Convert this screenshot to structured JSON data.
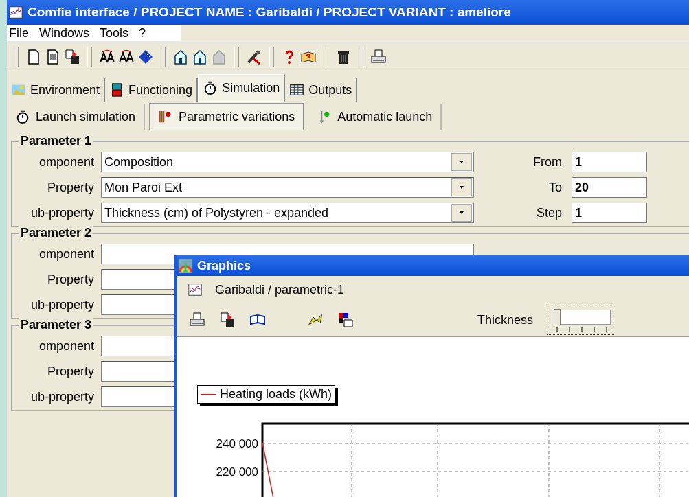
{
  "window": {
    "title": "Comfie interface  /  PROJECT NAME : Garibaldi  /  PROJECT VARIANT : ameliore"
  },
  "menu": [
    "File",
    "Windows",
    "Tools",
    "?"
  ],
  "tabs": [
    {
      "label": "Environment",
      "selected": false
    },
    {
      "label": "Functioning",
      "selected": false
    },
    {
      "label": "Simulation",
      "selected": true
    },
    {
      "label": "Outputs",
      "selected": false
    }
  ],
  "subtabs": [
    {
      "label": "Launch simulation",
      "selected": false
    },
    {
      "label": "Parametric variations",
      "selected": true
    },
    {
      "label": "Automatic launch",
      "selected": false
    }
  ],
  "parameters": [
    {
      "title": "Parameter 1",
      "rows": [
        {
          "label": "omponent",
          "value": "Composition"
        },
        {
          "label": "Property",
          "value": "Mon Paroi Ext"
        },
        {
          "label": "ub-property",
          "value": "Thickness (cm) of Polystyren - expanded"
        }
      ],
      "range": [
        {
          "label": "From",
          "value": "1"
        },
        {
          "label": "To",
          "value": "20"
        },
        {
          "label": "Step",
          "value": "1"
        }
      ]
    },
    {
      "title": "Parameter 2",
      "rows": [
        {
          "label": "omponent"
        },
        {
          "label": "Property"
        },
        {
          "label": "ub-property"
        }
      ]
    },
    {
      "title": "Parameter 3",
      "rows": [
        {
          "label": "omponent"
        },
        {
          "label": "Property"
        },
        {
          "label": "ub-property"
        }
      ]
    }
  ],
  "graphics": {
    "title": "Graphics",
    "subtitle": "Garibaldi / parametric-1",
    "slider": {
      "label": "Thickness",
      "level": 0
    },
    "plot": {
      "axis_labels": [
        "240 000",
        "220 000"
      ],
      "legend": [
        {
          "name": "Heating loads (kWh)",
          "color": "#cc2020"
        }
      ]
    }
  }
}
